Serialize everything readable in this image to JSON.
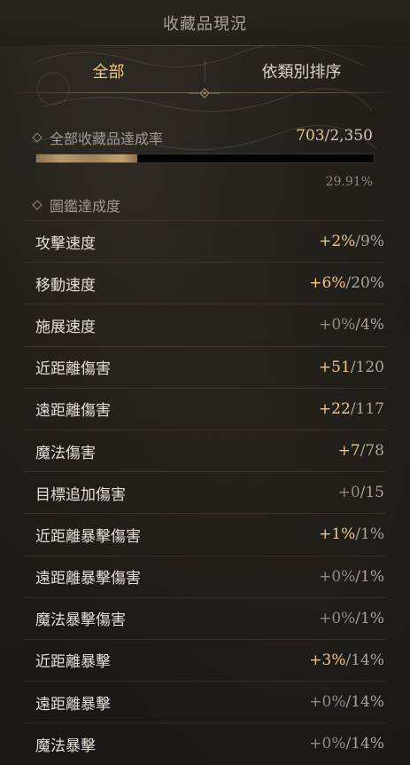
{
  "window": {
    "title": "收藏品現況"
  },
  "tabs": [
    {
      "label": "全部",
      "active": true
    },
    {
      "label": "依類別排序",
      "active": false
    }
  ],
  "overall": {
    "label": "全部收藏品達成率",
    "current": "703",
    "separator": "/",
    "max": "2,350",
    "progress_fraction": 0.2991,
    "percent_text": "29.91%"
  },
  "codex": {
    "label": "圖鑑達成度"
  },
  "stats": [
    {
      "label": "攻擊速度",
      "bonus": "+2%",
      "cap": "/9%",
      "active": true
    },
    {
      "label": "移動速度",
      "bonus": "+6%",
      "cap": "/20%",
      "active": true
    },
    {
      "label": "施展速度",
      "bonus": "+0%",
      "cap": "/4%",
      "active": false
    },
    {
      "label": "近距離傷害",
      "bonus": "+51",
      "cap": "/120",
      "active": true
    },
    {
      "label": "遠距離傷害",
      "bonus": "+22",
      "cap": "/117",
      "active": true
    },
    {
      "label": "魔法傷害",
      "bonus": "+7",
      "cap": "/78",
      "active": true
    },
    {
      "label": "目標追加傷害",
      "bonus": "+0",
      "cap": "/15",
      "active": false
    },
    {
      "label": "近距離暴擊傷害",
      "bonus": "+1%",
      "cap": "/1%",
      "active": true
    },
    {
      "label": "遠距離暴擊傷害",
      "bonus": "+0%",
      "cap": "/1%",
      "active": false
    },
    {
      "label": "魔法暴擊傷害",
      "bonus": "+0%",
      "cap": "/1%",
      "active": false
    },
    {
      "label": "近距離暴擊",
      "bonus": "+3%",
      "cap": "/14%",
      "active": true
    },
    {
      "label": "遠距離暴擊",
      "bonus": "+0%",
      "cap": "/14%",
      "active": false
    },
    {
      "label": "魔法暴擊",
      "bonus": "+0%",
      "cap": "/14%",
      "active": false
    }
  ],
  "colors": {
    "accent_gold": "#e9c98a",
    "text_primary": "#e3dfd7",
    "text_muted": "#9a958c",
    "background": "#1c1a17"
  }
}
